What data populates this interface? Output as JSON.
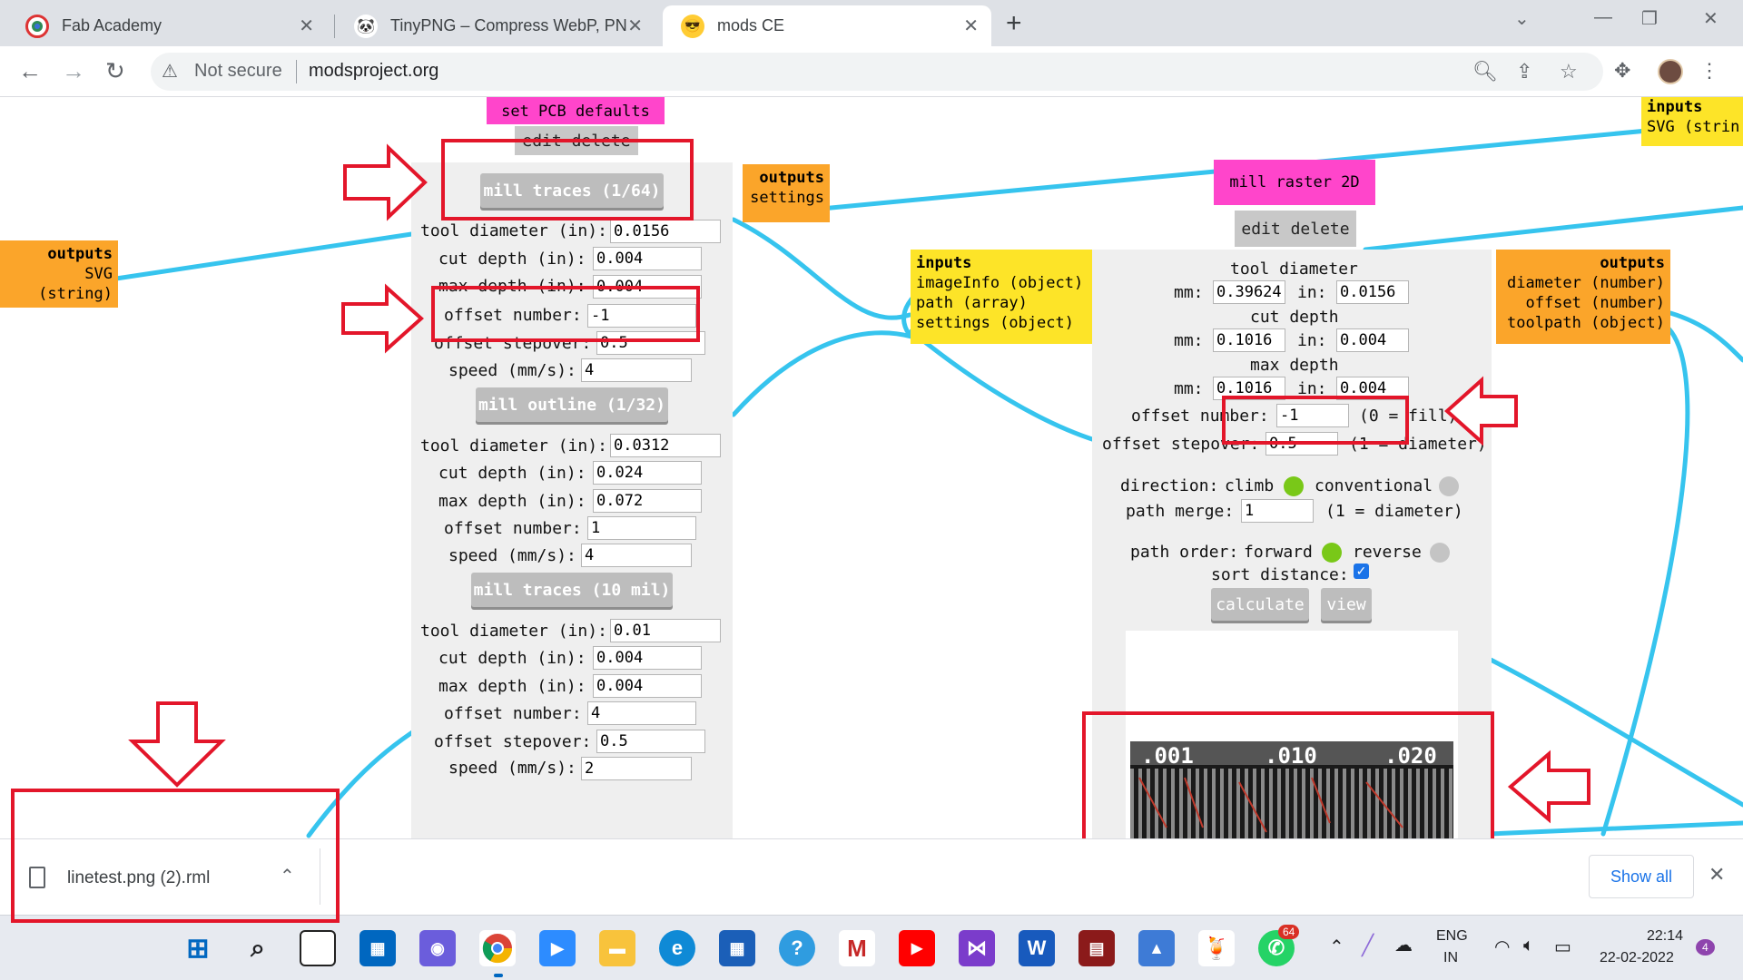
{
  "browser": {
    "tabs": [
      {
        "title": "Fab Academy",
        "icon": "fab-academy-icon",
        "active": false
      },
      {
        "title": "TinyPNG – Compress WebP, PNG",
        "icon": "panda-icon",
        "active": false
      },
      {
        "title": "mods CE",
        "icon": "sunglasses-emoji-icon",
        "active": true
      }
    ],
    "new_tab": "+",
    "address": {
      "security": "Not secure",
      "url": "modsproject.org"
    }
  },
  "mods": {
    "top_fragments": {
      "set_pcb_defaults": "set PCB defaults",
      "edit": "edit",
      "delete": "delete"
    },
    "set_pcb": {
      "mill_traces_64": "mill traces (1/64)",
      "traces_64": {
        "tool_diameter": {
          "label": "tool diameter (in):",
          "value": "0.0156"
        },
        "cut_depth": {
          "label": "cut depth (in):",
          "value": "0.004"
        },
        "max_depth": {
          "label": "max depth (in):",
          "value": "0.004"
        },
        "offset_number": {
          "label": "offset number:",
          "value": "-1"
        },
        "offset_stepover": {
          "label": "offset stepover:",
          "value": "0.5"
        },
        "speed": {
          "label": "speed (mm/s):",
          "value": "4"
        }
      },
      "mill_outline_32": "mill outline (1/32)",
      "outline_32": {
        "tool_diameter": {
          "label": "tool diameter (in):",
          "value": "0.0312"
        },
        "cut_depth": {
          "label": "cut depth (in):",
          "value": "0.024"
        },
        "max_depth": {
          "label": "max depth (in):",
          "value": "0.072"
        },
        "offset_number": {
          "label": "offset number:",
          "value": "1"
        },
        "speed": {
          "label": "speed (mm/s):",
          "value": "4"
        }
      },
      "mill_traces_10": "mill traces (10 mil)",
      "traces_10": {
        "tool_diameter": {
          "label": "tool diameter (in):",
          "value": "0.01"
        },
        "cut_depth": {
          "label": "cut depth (in):",
          "value": "0.004"
        },
        "max_depth": {
          "label": "max depth (in):",
          "value": "0.004"
        },
        "offset_number": {
          "label": "offset number:",
          "value": "4"
        },
        "offset_stepover": {
          "label": "offset stepover:",
          "value": "0.5"
        },
        "speed": {
          "label": "speed (mm/s):",
          "value": "2"
        }
      },
      "outputs": {
        "title": "outputs",
        "items": [
          "settings"
        ]
      }
    },
    "left_outputs": {
      "title": "outputs",
      "items": [
        "SVG (string)"
      ]
    },
    "top_right_inputs": {
      "title": "inputs",
      "items": [
        "SVG (strin"
      ]
    },
    "raster": {
      "title": "mill raster 2D",
      "edit": "edit",
      "delete": "delete",
      "inputs": {
        "title": "inputs",
        "items": [
          "imageInfo (object)",
          "path (array)",
          "settings (object)"
        ]
      },
      "outputs": {
        "title": "outputs",
        "items": [
          "diameter (number)",
          "offset (number)",
          "toolpath (object)"
        ]
      },
      "tool_diameter": {
        "label": "tool diameter",
        "mm_label": "mm:",
        "mm": "0.39624",
        "in_label": "in:",
        "in": "0.0156"
      },
      "cut_depth": {
        "label": "cut depth",
        "mm_label": "mm:",
        "mm": "0.1016",
        "in_label": "in:",
        "in": "0.004"
      },
      "max_depth": {
        "label": "max depth",
        "mm_label": "mm:",
        "mm": "0.1016",
        "in_label": "in:",
        "in": "0.004"
      },
      "offset_number": {
        "label": "offset number:",
        "value": "-1",
        "hint": "(0 = fill)"
      },
      "offset_stepover": {
        "label": "offset stepover:",
        "value": "0.5",
        "hint": "(1 = diameter)"
      },
      "direction": {
        "label": "direction:",
        "climb": "climb",
        "conventional": "conventional"
      },
      "path_merge": {
        "label": "path merge:",
        "value": "1",
        "hint": "(1 = diameter)"
      },
      "path_order": {
        "label": "path order:",
        "forward": "forward",
        "reverse": "reverse"
      },
      "sort_distance": {
        "label": "sort distance:",
        "checked": true
      },
      "calculate": "calculate",
      "view": "view",
      "preview_labels": [
        ".001",
        ".010",
        ".020"
      ]
    }
  },
  "downloads": {
    "file": "linetest.png (2).rml",
    "show_all": "Show all"
  },
  "taskbar": {
    "lang": "ENG",
    "region": "IN",
    "time": "22:14",
    "date": "22-02-2022",
    "notif_count": "4",
    "whatsapp_badge": "64"
  },
  "colors": {
    "wire": "#36c4ee",
    "annotation": "#e3162a",
    "module_title": "#ff45cb",
    "inputs": "#fde428",
    "outputs": "#fba52a"
  }
}
